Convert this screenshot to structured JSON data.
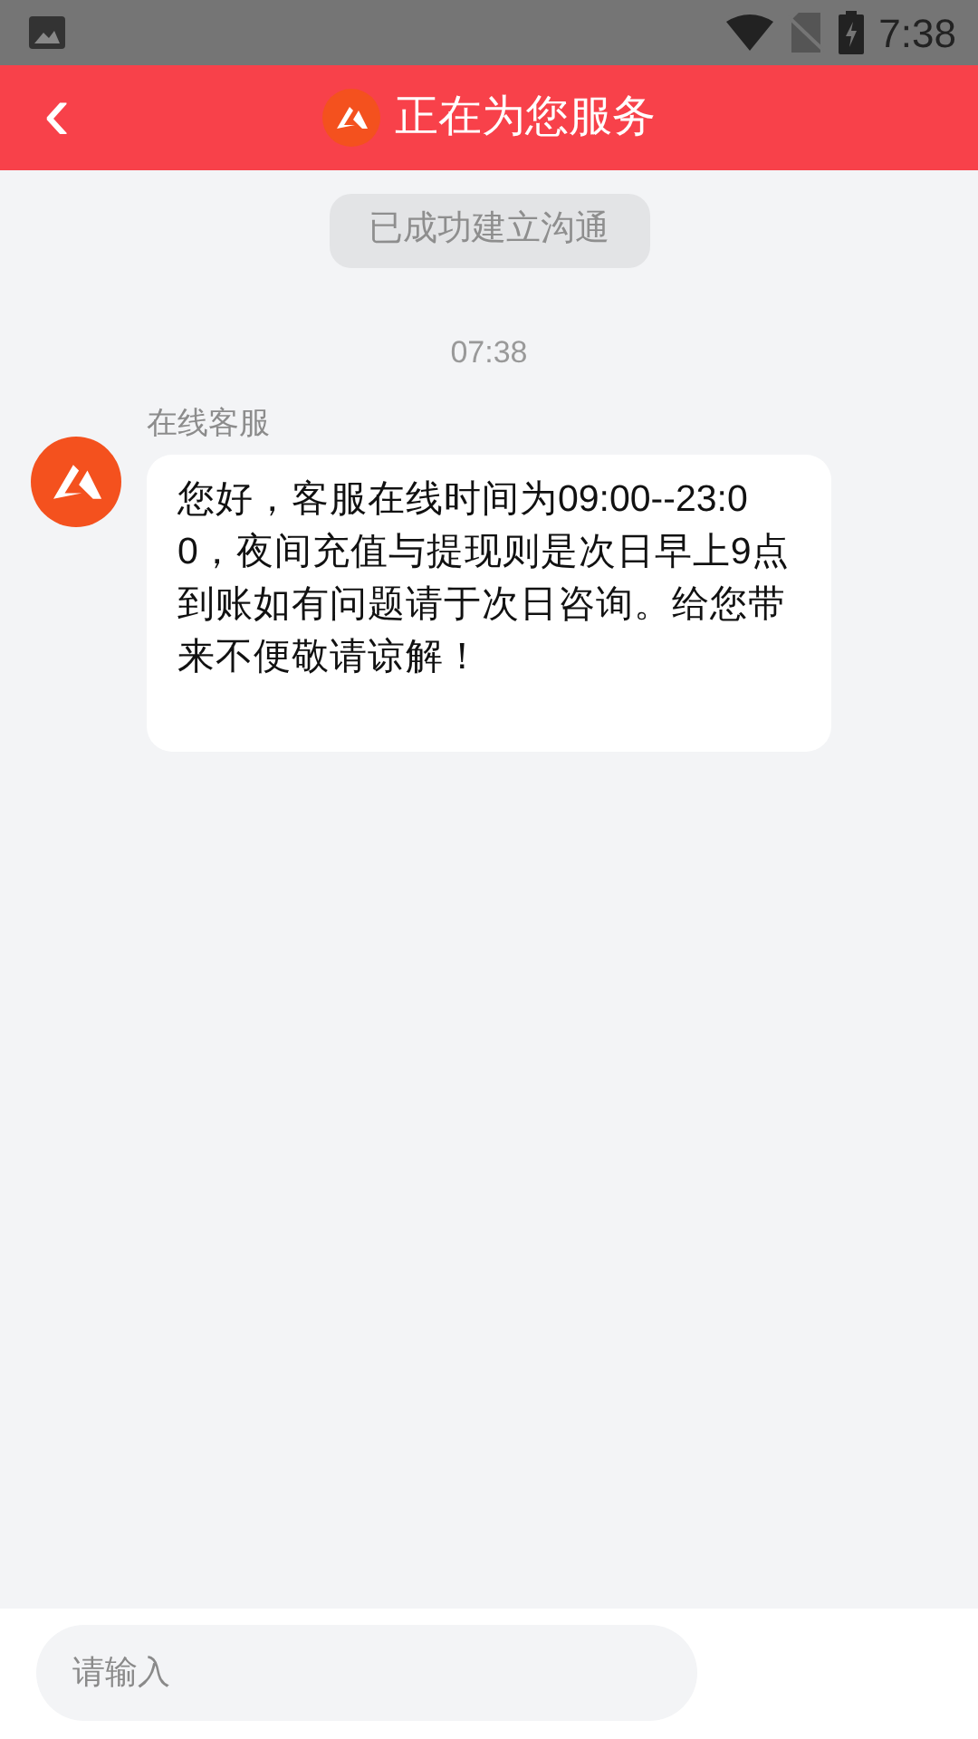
{
  "status_bar": {
    "time": "7:38"
  },
  "header": {
    "back": "‹",
    "title": "正在为您服务"
  },
  "system_notice": "已成功建立沟通",
  "timestamp": "07:38",
  "messages": [
    {
      "sender": "在线客服",
      "text": "您好，客服在线时间为09:00--23:00，夜间充值与提现则是次日早上9点到账如有问题请于次日咨询。给您带来不便敬请谅解！"
    }
  ],
  "composer": {
    "placeholder": "请输入"
  }
}
